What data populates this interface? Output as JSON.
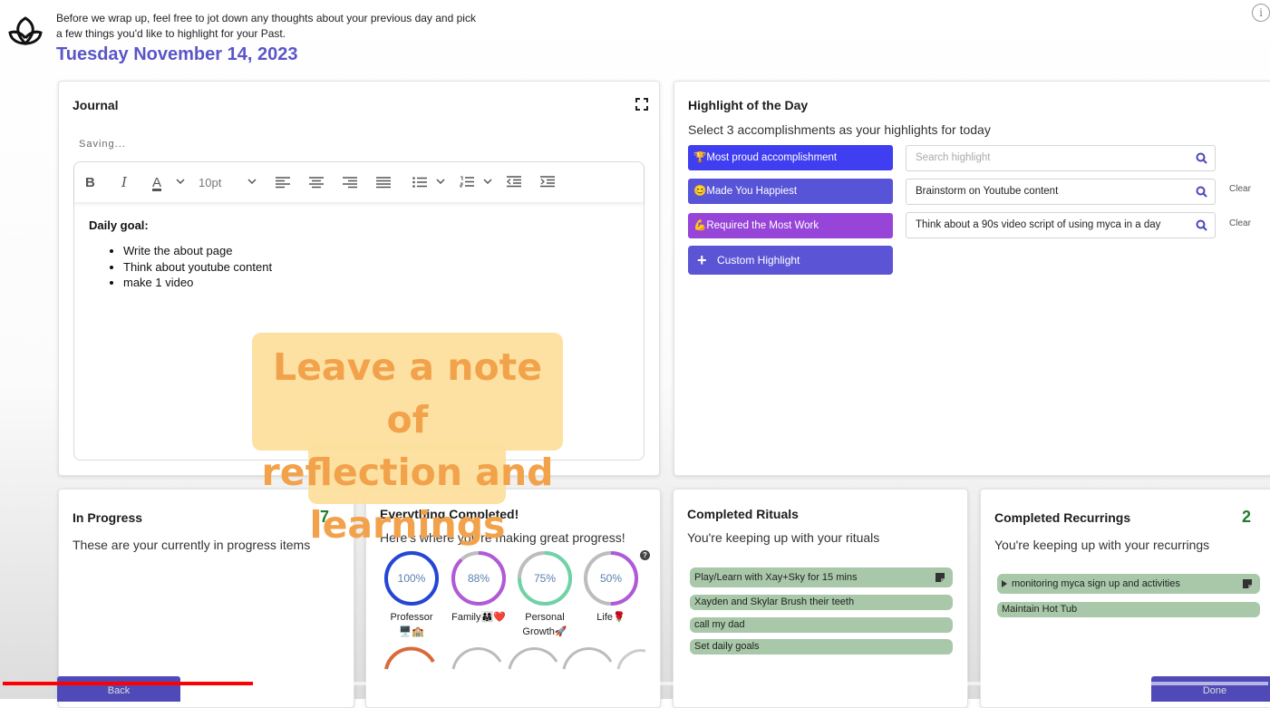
{
  "header": {
    "intro_line1": "Before we wrap up, feel free to jot down any thoughts about your previous day and pick",
    "intro_line2": "a few things you'd like to highlight for your Past.",
    "date": "Tuesday November 14, 2023",
    "info_icon": "i"
  },
  "journal": {
    "title": "Journal",
    "status": "Saving...",
    "toolbar": {
      "bold": "B",
      "italic": "I",
      "font_color": "A",
      "font_size": "10pt"
    },
    "goal_heading": "Daily goal:",
    "items": [
      "Write the about page",
      "Think about youtube content",
      "make 1 video"
    ]
  },
  "overlay": {
    "line1": "Leave a note of",
    "line2": "reflection and",
    "line3": "learnings"
  },
  "highlight": {
    "title": "Highlight of the Day",
    "subtitle": "Select 3 accomplishments as your highlights for today",
    "rows": [
      {
        "label": "🏆Most proud accomplishment",
        "value": "Search highlight",
        "color": "#3f3ef0",
        "clear": ""
      },
      {
        "label": "😊Made You Happiest",
        "value": "Brainstorm on Youtube content",
        "color": "#5754d8",
        "clear": "Clear"
      },
      {
        "label": "💪Required the Most Work",
        "value": "Think about a 90s video script of using myca in a day",
        "color": "#9645d8",
        "clear": "Clear"
      }
    ],
    "custom_label": "Custom Highlight",
    "custom_plus": "+"
  },
  "in_progress": {
    "title": "In Progress",
    "count": "7",
    "subtitle": "These are your currently in progress items"
  },
  "everything": {
    "title": "Everything Completed!",
    "subtitle": "Here's where you're making great progress!",
    "help": "?",
    "rings": [
      {
        "pct_label": "100%",
        "value": 1.0,
        "color": "#2446d6",
        "label1": "Professor",
        "label2": "🖥️🏫"
      },
      {
        "pct_label": "88%",
        "value": 0.88,
        "color": "#b159d9",
        "label1": "Family👨‍👩‍👧❤️",
        "label2": ""
      },
      {
        "pct_label": "75%",
        "value": 0.75,
        "color": "#6fd3a7",
        "label1": "Personal",
        "label2": "Growth🚀"
      },
      {
        "pct_label": "50%",
        "value": 0.5,
        "color": "#b159d9",
        "label1": "Life🌹",
        "label2": ""
      }
    ]
  },
  "rituals": {
    "title": "Completed Rituals",
    "subtitle": "You're keeping up with your rituals",
    "items": [
      "Play/Learn with Xay+Sky for 15 mins",
      "Xayden and Skylar Brush their teeth",
      "call my dad",
      "Set daily goals"
    ]
  },
  "recurring": {
    "title": "Completed Recurrings",
    "count": "2",
    "subtitle": "You're keeping up with your recurrings",
    "items": [
      "monitoring myca sign up and activities",
      "Maintain Hot Tub"
    ]
  },
  "footer": {
    "back": "Back",
    "done": "Done",
    "video_progress": 0.198
  }
}
